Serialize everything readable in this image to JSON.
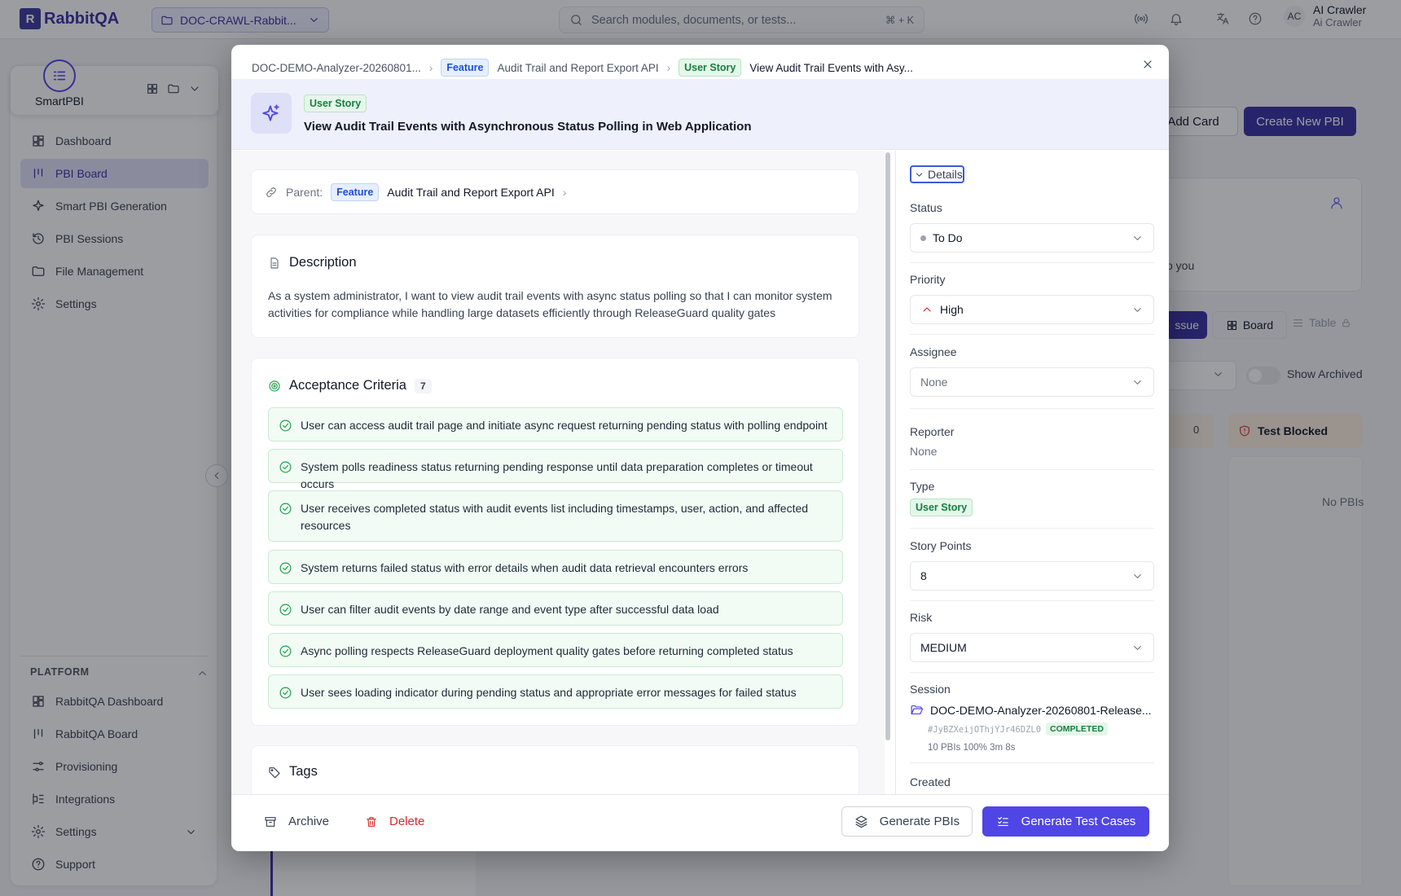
{
  "topbar": {
    "brand": "RabbitQA",
    "project": "DOC-CRAWL-Rabbit...",
    "search_placeholder": "Search modules, documents, or tests...",
    "search_shortcut": "⌘ + K",
    "user_initials": "AC",
    "user_name": "AI Crawler",
    "user_role": "Ai Crawler"
  },
  "sidebar": {
    "app_name": "SmartPBI",
    "items": [
      {
        "label": "Dashboard",
        "icon": "dashboard-icon"
      },
      {
        "label": "PBI Board",
        "icon": "board-icon",
        "active": true
      },
      {
        "label": "Smart PBI Generation",
        "icon": "sparkle-icon"
      },
      {
        "label": "PBI Sessions",
        "icon": "history-icon"
      },
      {
        "label": "File Management",
        "icon": "folder-icon"
      },
      {
        "label": "Settings",
        "icon": "gear-icon"
      }
    ],
    "platform_label": "PLATFORM",
    "platform_items": [
      {
        "label": "RabbitQA Dashboard",
        "icon": "dashboard-icon"
      },
      {
        "label": "RabbitQA Board",
        "icon": "board-icon"
      },
      {
        "label": "Provisioning",
        "icon": "sliders-icon"
      },
      {
        "label": "Integrations",
        "icon": "integrations-icon"
      },
      {
        "label": "Settings",
        "icon": "gear-icon"
      },
      {
        "label": "Support",
        "icon": "help-icon"
      }
    ]
  },
  "background": {
    "add_card": "Add Card",
    "create_pbi": "Create New PBI",
    "card_text": "o you",
    "issue_btn": "ssue",
    "board_tab": "Board",
    "table_tab": "Table",
    "show_archived": "Show Archived",
    "col_count": "0",
    "test_blocked": "Test Blocked",
    "no_pbis": "No PBIs"
  },
  "modal": {
    "breadcrumb": {
      "doc": "DOC-DEMO-Analyzer-20260801...",
      "feature_badge": "Feature",
      "feature": "Audit Trail and Report Export API",
      "story_badge": "User Story",
      "story": "View Audit Trail Events with Asy..."
    },
    "header": {
      "type_badge": "User Story",
      "title": "View Audit Trail Events with Asynchronous Status Polling in Web Application"
    },
    "parent": {
      "label": "Parent:",
      "badge": "Feature",
      "title": "Audit Trail and Report Export API"
    },
    "description": {
      "title": "Description",
      "text": "As a system administrator, I want to view audit trail events with async status polling so that I can monitor system activities for compliance while handling large datasets efficiently through ReleaseGuard quality gates"
    },
    "acceptance": {
      "title": "Acceptance Criteria",
      "count": "7",
      "items": [
        "User can access audit trail page and initiate async request returning pending status with polling endpoint",
        "System polls readiness status returning pending response until data preparation completes or timeout occurs",
        "User receives completed status with audit events list including timestamps, user, action, and affected resources",
        "System returns failed status with error details when audit data retrieval encounters errors",
        "User can filter audit events by date range and event type after successful data load",
        "Async polling respects ReleaseGuard deployment quality gates before returning completed status",
        "User sees loading indicator during pending status and appropriate error messages for failed status"
      ]
    },
    "tags": {
      "title": "Tags"
    },
    "details": {
      "toggle": "Details",
      "status_label": "Status",
      "status": "To Do",
      "priority_label": "Priority",
      "priority": "High",
      "assignee_label": "Assignee",
      "assignee": "None",
      "reporter_label": "Reporter",
      "reporter": "None",
      "type_label": "Type",
      "type": "User Story",
      "points_label": "Story Points",
      "points": "8",
      "risk_label": "Risk",
      "risk": "MEDIUM",
      "session_label": "Session",
      "session_name": "DOC-DEMO-Analyzer-20260801-Release...",
      "session_id": "#JyBZXeijOThjYJr46DZL0",
      "session_status": "COMPLETED",
      "session_meta": "10 PBIs 100% 3m 8s",
      "created_label": "Created"
    },
    "footer": {
      "archive": "Archive",
      "delete": "Delete",
      "generate_pbis": "Generate PBIs",
      "generate_tests": "Generate Test Cases"
    }
  },
  "colors": {
    "primary": "#4f46e5",
    "brand": "#3730a3",
    "success": "#16a34a",
    "danger": "#dc2626"
  }
}
